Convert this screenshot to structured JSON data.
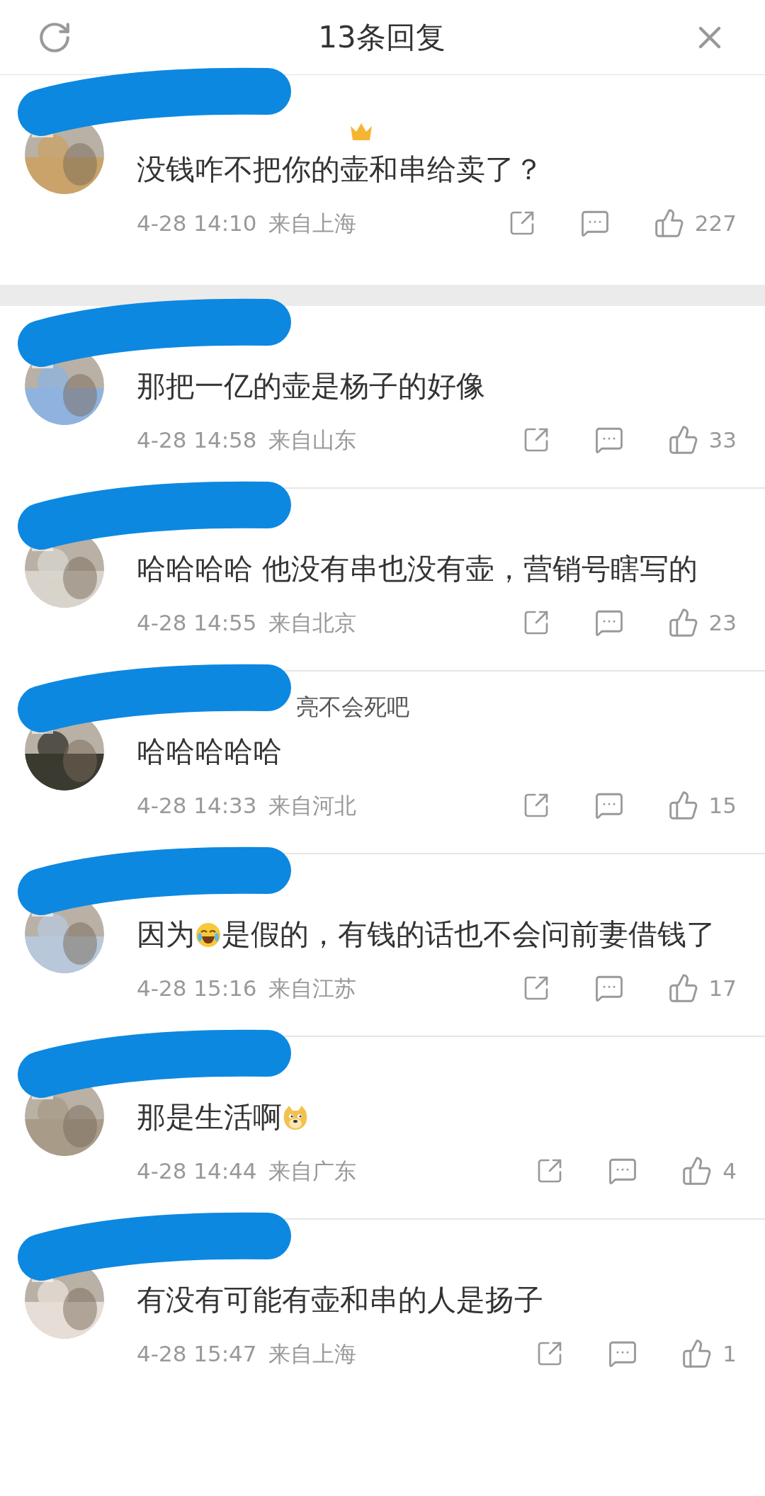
{
  "header": {
    "title": "13条回复"
  },
  "comments": [
    {
      "vip": true,
      "segments": [
        {
          "kind": "text",
          "text": "没钱咋不把你的壶和串给卖了？"
        }
      ],
      "time": "4-28 14:10",
      "location": "来自上海",
      "likes": "227"
    },
    {
      "vip": false,
      "segments": [
        {
          "kind": "text",
          "text": "那把一亿的壶是杨子的好像"
        }
      ],
      "time": "4-28 14:58",
      "location": "来自山东",
      "likes": "33"
    },
    {
      "vip": false,
      "segments": [
        {
          "kind": "text",
          "text": "哈哈哈哈 他没有串也没有壶，营销号瞎写的"
        }
      ],
      "time": "4-28 14:55",
      "location": "来自北京",
      "likes": "23"
    },
    {
      "name": "亮不会死吧",
      "vip": false,
      "segments": [
        {
          "kind": "text",
          "text": "哈哈哈哈哈"
        }
      ],
      "time": "4-28 14:33",
      "location": "来自河北",
      "likes": "15"
    },
    {
      "vip": false,
      "segments": [
        {
          "kind": "text",
          "text": "因为"
        },
        {
          "kind": "laugh"
        },
        {
          "kind": "text",
          "text": "是假的，有钱的话也不会问前妻借钱了"
        }
      ],
      "time": "4-28 15:16",
      "location": "来自江苏",
      "likes": "17"
    },
    {
      "vip": false,
      "segments": [
        {
          "kind": "text",
          "text": "那是生活啊"
        },
        {
          "kind": "doge"
        }
      ],
      "time": "4-28 14:44",
      "location": "来自广东",
      "likes": "4"
    },
    {
      "vip": false,
      "segments": [
        {
          "kind": "text",
          "text": "有没有可能有壶和串的人是扬子"
        }
      ],
      "time": "4-28 15:47",
      "location": "来自上海",
      "likes": "1"
    }
  ]
}
